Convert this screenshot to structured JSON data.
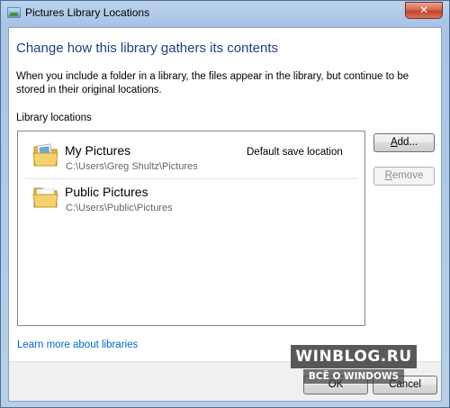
{
  "window": {
    "title": "Pictures Library Locations",
    "close_glyph": "✕"
  },
  "heading": "Change how this library gathers its contents",
  "description": "When you include a folder in a library, the files appear in the library, but continue to be stored in their original locations.",
  "locations_label": "Library locations",
  "locations": [
    {
      "name": "My Pictures",
      "path": "C:\\Users\\Greg Shultz\\Pictures",
      "badge": "Default save location",
      "icon": "pictures-folder-icon"
    },
    {
      "name": "Public Pictures",
      "path": "C:\\Users\\Public\\Pictures",
      "badge": "",
      "icon": "folder-icon"
    }
  ],
  "buttons": {
    "add_prefix": "",
    "add_accel": "A",
    "add_rest": "dd...",
    "remove_prefix": "",
    "remove_accel": "R",
    "remove_rest": "emove",
    "ok": "OK",
    "cancel": "Cancel"
  },
  "learn_more": "Learn more about libraries",
  "watermark": {
    "line1": "WINBLOG.RU",
    "line2": "ВСЁ О WINDOWS"
  },
  "colors": {
    "heading": "#1e3f84",
    "link": "#0066cc",
    "close_button": "#c4432a"
  }
}
